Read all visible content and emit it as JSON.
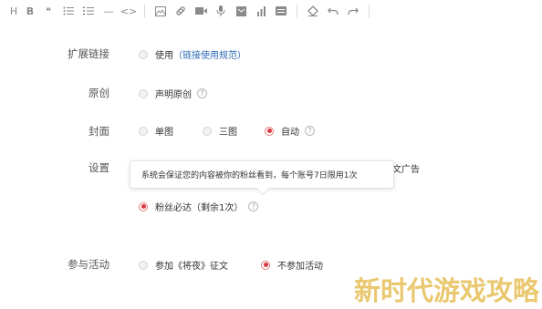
{
  "toolbar": {
    "items": [
      {
        "name": "heading-icon",
        "text": "H"
      },
      {
        "name": "bold-icon",
        "text": "B"
      },
      {
        "name": "quote-icon",
        "text": "❝"
      },
      {
        "name": "bullet-list-icon",
        "text": "≔"
      },
      {
        "name": "numbered-list-icon",
        "text": "≡"
      },
      {
        "name": "horizontal-rule-icon",
        "text": "—"
      },
      {
        "name": "code-icon",
        "text": "<>"
      }
    ],
    "media_items": [
      "image-icon",
      "link-icon",
      "video-icon",
      "audio-icon",
      "file-icon",
      "chart-icon",
      "card-icon"
    ],
    "edit_items": [
      "eraser-icon",
      "undo-icon",
      "redo-icon"
    ]
  },
  "extended_link": {
    "label": "扩展链接",
    "option": "使用",
    "link_text": "（链接使用规范）"
  },
  "original": {
    "label": "原创",
    "option": "声明原创",
    "help": "?"
  },
  "cover": {
    "label": "封面",
    "options": [
      "单图",
      "三图",
      "自动"
    ],
    "selected": "自动",
    "help": "?"
  },
  "settings": {
    "label": "设置",
    "hidden_text": "文广告",
    "tooltip": "系统会保证您的内容被你的粉丝看到，每个账号7日限用1次",
    "option": "粉丝必达（剩余1次）",
    "help": "?"
  },
  "activity": {
    "label": "参与活动",
    "options": [
      "参加《将夜》征文",
      "不参加活动"
    ],
    "selected": "不参加活动"
  },
  "watermark": "新时代游戏攻略",
  "colors": {
    "accent": "#d9363e",
    "link": "#2b6ab3",
    "watermark": "#e9c870"
  }
}
